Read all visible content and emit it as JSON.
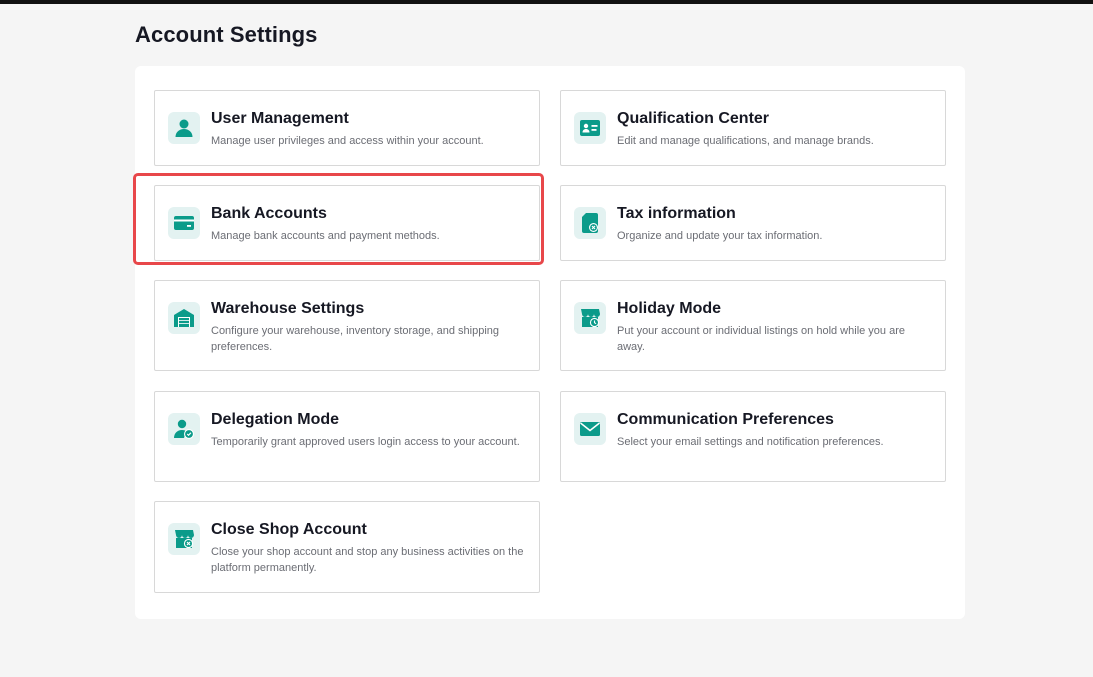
{
  "page": {
    "title": "Account Settings"
  },
  "theme": {
    "accent": "#0b9b8a",
    "icon_bg": "#e3f2f1",
    "highlight": "#e8474a"
  },
  "cards": [
    {
      "title": "User Management",
      "desc": "Manage user privileges and access within your account.",
      "icon": "user-icon"
    },
    {
      "title": "Qualification Center",
      "desc": "Edit and manage qualifications, and manage brands.",
      "icon": "id-card-icon"
    },
    {
      "title": "Bank Accounts",
      "desc": "Manage bank accounts and payment methods.",
      "icon": "bank-card-icon"
    },
    {
      "title": "Tax information",
      "desc": "Organize and update your tax information.",
      "icon": "tax-document-icon"
    },
    {
      "title": "Warehouse Settings",
      "desc": "Configure your warehouse, inventory storage, and shipping preferences.",
      "icon": "warehouse-icon"
    },
    {
      "title": "Holiday Mode",
      "desc": "Put your account or individual listings on hold while you are away.",
      "icon": "store-clock-icon"
    },
    {
      "title": "Delegation Mode",
      "desc": "Temporarily grant approved users login access to your account.",
      "icon": "user-check-icon"
    },
    {
      "title": "Communication Preferences",
      "desc": "Select your email settings and notification preferences.",
      "icon": "envelope-icon"
    },
    {
      "title": "Close Shop Account",
      "desc": "Close your shop account and stop any business activities on the platform permanently.",
      "icon": "store-close-icon"
    }
  ]
}
